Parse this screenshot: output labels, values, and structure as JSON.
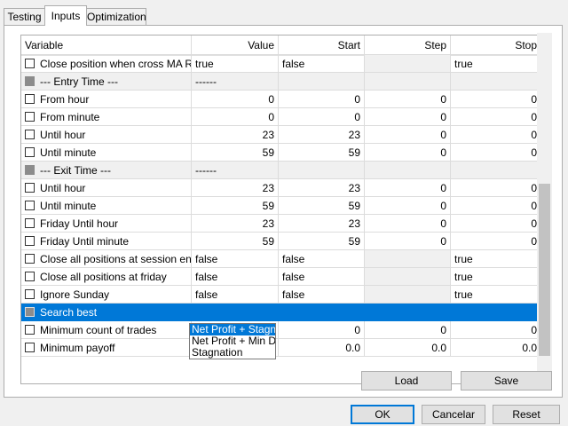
{
  "tabs": [
    "Testing",
    "Inputs",
    "Optimization"
  ],
  "columns": [
    "Variable",
    "Value",
    "Start",
    "Step",
    "Stop"
  ],
  "rows": [
    {
      "name": "Close position when cross MA R...",
      "value": "true",
      "start": "false",
      "step": "",
      "stop": "true",
      "type": "bool"
    },
    {
      "name": "--- Entry Time ---",
      "value": "------",
      "start": "",
      "step": "",
      "stop": "",
      "type": "group"
    },
    {
      "name": "From hour",
      "value": "0",
      "start": "0",
      "step": "0",
      "stop": "0",
      "type": "num"
    },
    {
      "name": "From minute",
      "value": "0",
      "start": "0",
      "step": "0",
      "stop": "0",
      "type": "num"
    },
    {
      "name": "Until hour",
      "value": "23",
      "start": "23",
      "step": "0",
      "stop": "0",
      "type": "num"
    },
    {
      "name": "Until minute",
      "value": "59",
      "start": "59",
      "step": "0",
      "stop": "0",
      "type": "num"
    },
    {
      "name": "--- Exit Time ---",
      "value": "------",
      "start": "",
      "step": "",
      "stop": "",
      "type": "group"
    },
    {
      "name": "Until hour",
      "value": "23",
      "start": "23",
      "step": "0",
      "stop": "0",
      "type": "num"
    },
    {
      "name": "Until minute",
      "value": "59",
      "start": "59",
      "step": "0",
      "stop": "0",
      "type": "num"
    },
    {
      "name": "Friday Until hour",
      "value": "23",
      "start": "23",
      "step": "0",
      "stop": "0",
      "type": "num"
    },
    {
      "name": "Friday Until minute",
      "value": "59",
      "start": "59",
      "step": "0",
      "stop": "0",
      "type": "num"
    },
    {
      "name": "Close all positions at session endi...",
      "value": "false",
      "start": "false",
      "step": "",
      "stop": "true",
      "type": "bool"
    },
    {
      "name": "Close all positions at friday",
      "value": "false",
      "start": "false",
      "step": "",
      "stop": "true",
      "type": "bool"
    },
    {
      "name": "Ignore Sunday",
      "value": "false",
      "start": "false",
      "step": "",
      "stop": "true",
      "type": "bool"
    },
    {
      "name": "Search best",
      "value": "Net Profit + Stagnation",
      "start": "",
      "step": "",
      "stop": "",
      "type": "selected"
    },
    {
      "name": "Minimum count of trades",
      "value": "",
      "start": "0",
      "step": "0",
      "stop": "0",
      "type": "num"
    },
    {
      "name": "Minimum payoff",
      "value": "",
      "start": "0.0",
      "step": "0.0",
      "stop": "0.0",
      "type": "num"
    }
  ],
  "dropdown_options": [
    "Net Profit + Stagnation",
    "Net Profit + Min DD",
    "Stagnation"
  ],
  "buttons": {
    "load": "Load",
    "save": "Save",
    "ok": "OK",
    "cancel": "Cancelar",
    "reset": "Reset"
  }
}
